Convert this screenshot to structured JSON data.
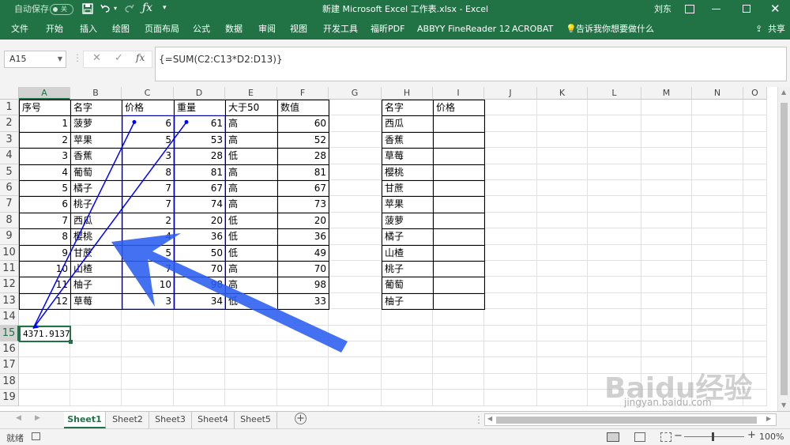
{
  "titlebar": {
    "autosave_label": "自动保存",
    "autosave_state": "关",
    "title": "新建 Microsoft Excel 工作表.xlsx - Excel",
    "user": "刘东"
  },
  "ribbon": {
    "tabs": [
      "文件",
      "开始",
      "插入",
      "绘图",
      "页面布局",
      "公式",
      "数据",
      "审阅",
      "视图",
      "开发工具",
      "福昕PDF",
      "ABBYY FineReader 12",
      "ACROBAT"
    ],
    "tell_me": "告诉我你想要做什么",
    "share": "共享"
  },
  "formula": {
    "name_box": "A15",
    "fx": "fx",
    "content": "{=SUM(C2:C13*D2:D13)}"
  },
  "columns": [
    "A",
    "B",
    "C",
    "D",
    "E",
    "F",
    "G",
    "H",
    "I",
    "J",
    "K",
    "L",
    "M",
    "N",
    "O"
  ],
  "rows": [
    "1",
    "2",
    "3",
    "4",
    "5",
    "6",
    "7",
    "8",
    "9",
    "10",
    "11",
    "12",
    "13",
    "14",
    "15",
    "16",
    "17",
    "18",
    "19"
  ],
  "table1": {
    "headers": [
      "序号",
      "名字",
      "价格",
      "重量",
      "大于50",
      "数值"
    ],
    "rows": [
      [
        "1",
        "菠萝",
        "6",
        "61",
        "高",
        "60"
      ],
      [
        "2",
        "苹果",
        "5",
        "53",
        "高",
        "52"
      ],
      [
        "3",
        "香蕉",
        "3",
        "28",
        "低",
        "28"
      ],
      [
        "4",
        "葡萄",
        "8",
        "81",
        "高",
        "81"
      ],
      [
        "5",
        "橘子",
        "7",
        "67",
        "高",
        "67"
      ],
      [
        "6",
        "桃子",
        "7",
        "74",
        "高",
        "73"
      ],
      [
        "7",
        "西瓜",
        "2",
        "20",
        "低",
        "20"
      ],
      [
        "8",
        "樱桃",
        "4",
        "36",
        "低",
        "36"
      ],
      [
        "9",
        "甘蔗",
        "5",
        "50",
        "低",
        "49"
      ],
      [
        "10",
        "山楂",
        "7",
        "70",
        "高",
        "70"
      ],
      [
        "11",
        "柚子",
        "10",
        "98",
        "高",
        "98"
      ],
      [
        "12",
        "草莓",
        "3",
        "34",
        "低",
        "33"
      ]
    ]
  },
  "result_cell": "4371.9137",
  "table2": {
    "headers": [
      "名字",
      "价格"
    ],
    "names": [
      "西瓜",
      "香蕉",
      "草莓",
      "樱桃",
      "甘蔗",
      "苹果",
      "菠萝",
      "橘子",
      "山楂",
      "桃子",
      "葡萄",
      "柚子"
    ]
  },
  "sheets": [
    "Sheet1",
    "Sheet2",
    "Sheet3",
    "Sheet4",
    "Sheet5"
  ],
  "active_sheet": "Sheet1",
  "status": {
    "ready": "就绪",
    "zoom": "100%"
  },
  "watermark": {
    "brand": "Baidu经验",
    "url": "jingyan.baidu.com"
  },
  "colors": {
    "excel_green": "#217346",
    "arrow_blue": "#2a5cf0",
    "precedent_blue": "#0000ff"
  }
}
